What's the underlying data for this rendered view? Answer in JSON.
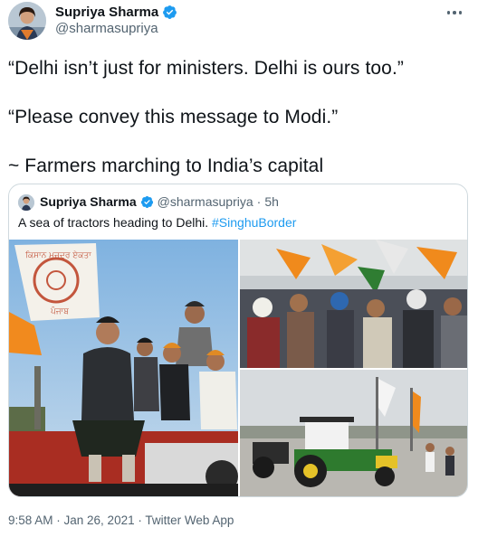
{
  "tweet": {
    "author_name": "Supriya Sharma",
    "author_handle": "@sharmasupriya",
    "lines": [
      "“Delhi isn’t just for ministers. Delhi is ours too.”",
      "“Please convey this message to Modi.”",
      "~ Farmers marching to India’s capital"
    ],
    "timestamp": "9:58 AM · Jan 26, 2021 · Twitter Web App"
  },
  "quoted": {
    "author_name": "Supriya Sharma",
    "author_handle": "@sharmasupriya",
    "separator": "·",
    "age": "5h",
    "text": "A sea of tractors heading to Delhi.",
    "hashtag": "#SinghuBorder"
  },
  "banner": {
    "lines": [
      "ਕਿਸਾਨ ਮਜ਼ਦੂਰ ਏਕਤਾ",
      "ਪੰਜਾਬ"
    ]
  },
  "icons": {
    "verified": "verified-badge-icon",
    "more": "more-options-icon"
  },
  "colors": {
    "accent": "#1d9bf0",
    "text": "#0f1419",
    "muted": "#536471",
    "border": "#cfd9de"
  }
}
